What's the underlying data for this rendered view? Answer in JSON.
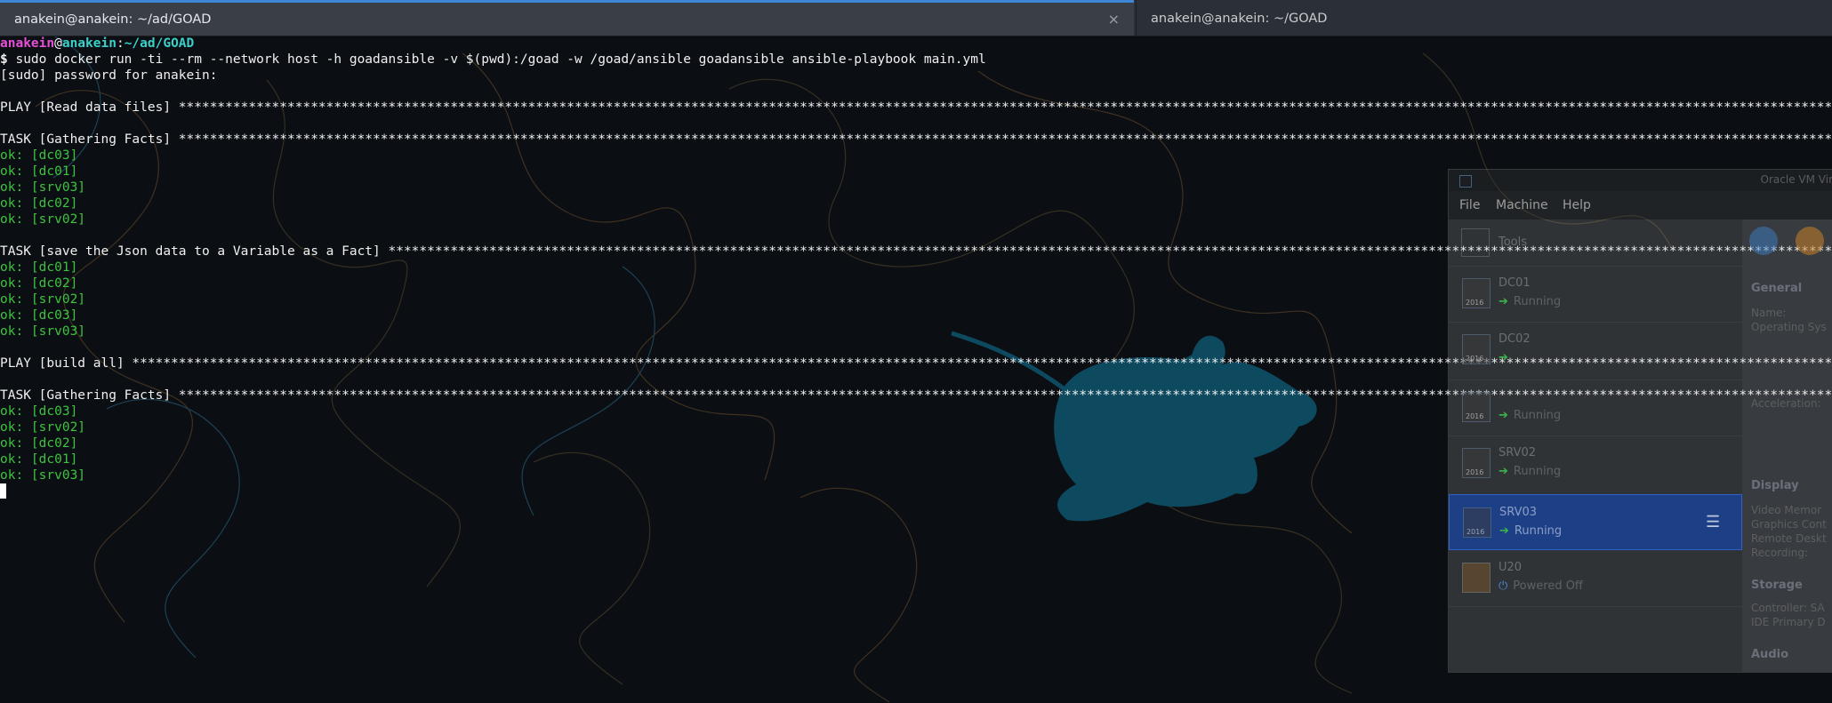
{
  "tabs": [
    {
      "title": "anakein@anakein: ~/ad/GOAD",
      "close": "×"
    },
    {
      "title": "anakein@anakein: ~/GOAD"
    }
  ],
  "terminal": {
    "prompt": {
      "user": "anakein",
      "at": "@",
      "host": "anakein",
      "sep": ":",
      "path": "~/ad/GOAD",
      "dollar": "$"
    },
    "command": " sudo docker run -ti --rm --network host -h goadansible -v $(pwd):/goad -w /goad/ansible goadansible ansible-playbook main.yml",
    "sudo": "[sudo] password for anakein:",
    "play1": "PLAY [Read data files] ***************************************************************************************************************************************************************************************************************************",
    "task1": "TASK [Gathering Facts] ***************************************************************************************************************************************************************************************************************************",
    "task1_results": [
      "ok: [dc03]",
      "ok: [dc01]",
      "ok: [srv03]",
      "ok: [dc02]",
      "ok: [srv02]"
    ],
    "task2": "TASK [save the Json data to a Variable as a Fact] ************************************************************************************************************************************************************************************************",
    "task2_results": [
      "ok: [dc01]",
      "ok: [dc02]",
      "ok: [srv02]",
      "ok: [dc03]",
      "ok: [srv03]"
    ],
    "play2": "PLAY [build all] *********************************************************************************************************************************************************************************************************************************",
    "task3": "TASK [Gathering Facts] ***************************************************************************************************************************************************************************************************************************",
    "task3_results": [
      "ok: [dc03]",
      "ok: [srv02]",
      "ok: [dc02]",
      "ok: [dc01]",
      "ok: [srv03]"
    ]
  },
  "vbox": {
    "title": "Oracle VM Vir",
    "menu": [
      "File",
      "Machine",
      "Help"
    ],
    "tools_label": "Tools",
    "vms": [
      {
        "name": "DC01",
        "state": "Running",
        "ver": "2016"
      },
      {
        "name": "DC02",
        "state": "",
        "ver": "2016"
      },
      {
        "name": "",
        "state": "Running",
        "ver": "2016"
      },
      {
        "name": "SRV02",
        "state": "Running",
        "ver": "2016"
      },
      {
        "name": "SRV03",
        "state": "Running",
        "ver": "2016"
      },
      {
        "name": "U20",
        "state": "Powered Off",
        "ver": ""
      }
    ],
    "details": {
      "general": "General",
      "name": "Name:",
      "os": "Operating Sys",
      "acceleration": "Acceleration:",
      "display": "Display",
      "video": "Video Memor",
      "graphics": "Graphics Cont",
      "remote": "Remote Deskt",
      "recording": "Recording:",
      "storage": "Storage",
      "controller": "Controller: SA",
      "ide": "IDE Primary D",
      "audio": "Audio"
    }
  }
}
